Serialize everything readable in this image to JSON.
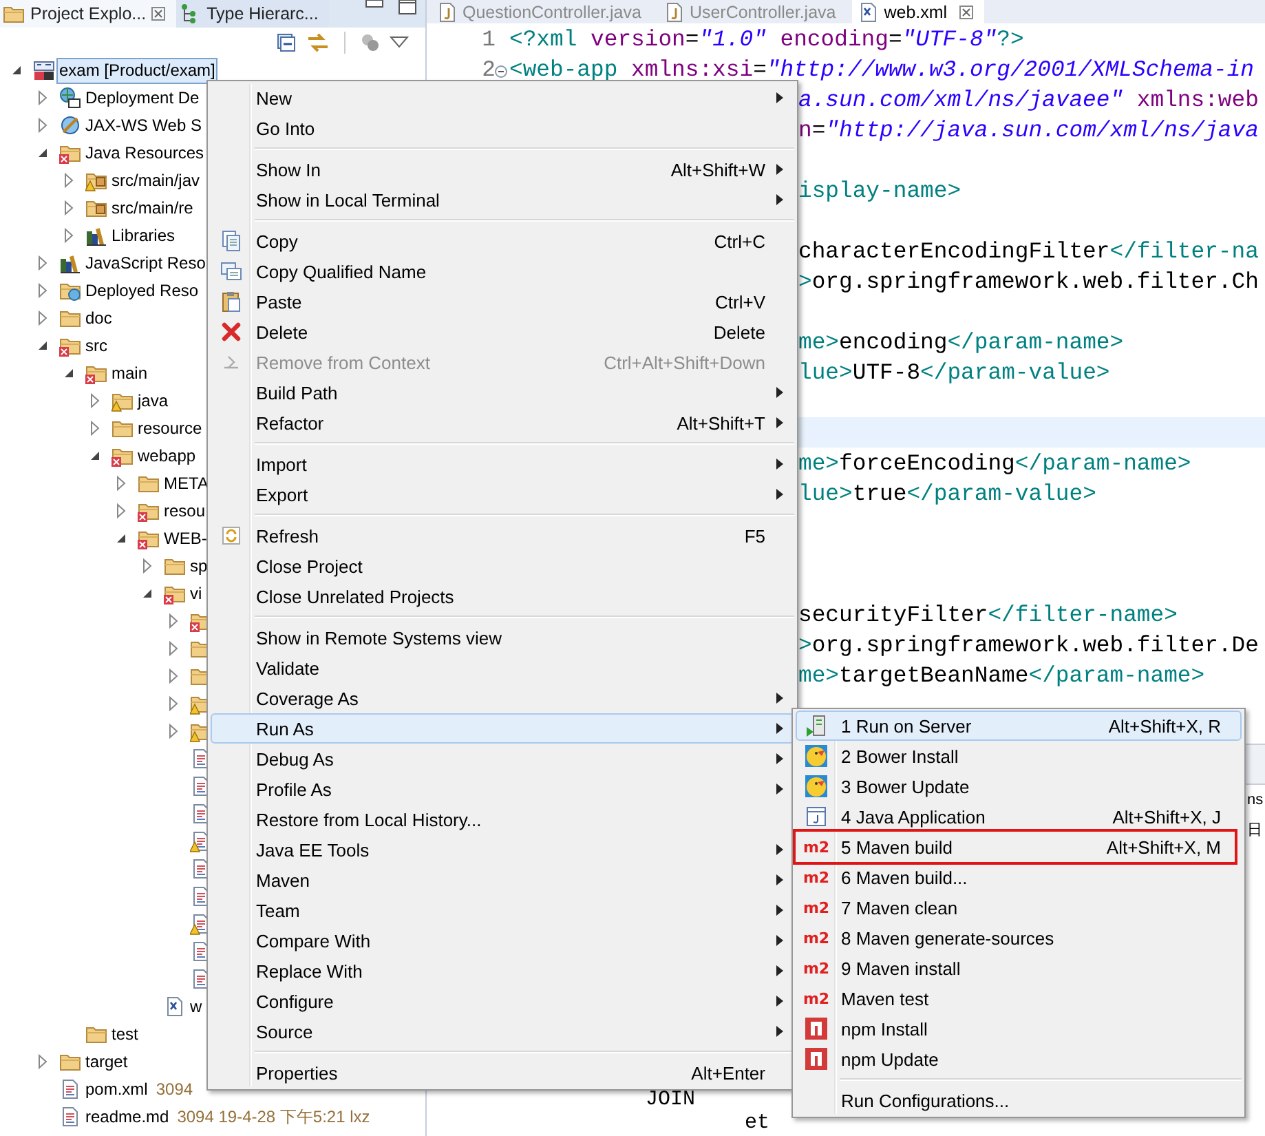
{
  "explorer": {
    "tabs": [
      {
        "label": "Project Explo...",
        "selected": true,
        "closable": true
      },
      {
        "label": "Type Hierarc...",
        "selected": false,
        "closable": false
      }
    ],
    "tree": [
      {
        "label": "exam [Product/exam]",
        "kind": "project",
        "expanded": true,
        "selected": true,
        "children": [
          {
            "label": "Deployment De",
            "kind": "deploy",
            "expanded": false,
            "selected": false
          },
          {
            "label": "JAX-WS Web S",
            "kind": "webservice",
            "expanded": false,
            "selected": false
          },
          {
            "label": "Java Resources",
            "kind": "javares",
            "expanded": true,
            "selected": false,
            "children": [
              {
                "label": "src/main/jav",
                "kind": "srcfolder-warning",
                "expanded": false,
                "selected": false
              },
              {
                "label": "src/main/re",
                "kind": "srcfolder",
                "expanded": false,
                "selected": false
              },
              {
                "label": "Libraries",
                "kind": "library",
                "expanded": false,
                "selected": false
              }
            ]
          },
          {
            "label": "JavaScript Reso",
            "kind": "library",
            "expanded": false,
            "selected": false
          },
          {
            "label": "Deployed Reso",
            "kind": "deployed",
            "expanded": false,
            "selected": false
          },
          {
            "label": "doc",
            "kind": "folder",
            "expanded": false,
            "selected": false
          },
          {
            "label": "src",
            "kind": "folder-error",
            "expanded": true,
            "selected": false,
            "children": [
              {
                "label": "main",
                "kind": "folder-error",
                "expanded": true,
                "selected": false,
                "children": [
                  {
                    "label": "java",
                    "kind": "folder-warning",
                    "expanded": false,
                    "selected": false
                  },
                  {
                    "label": "resource",
                    "kind": "folder",
                    "expanded": false,
                    "selected": false
                  },
                  {
                    "label": "webapp",
                    "kind": "folder-error",
                    "expanded": true,
                    "selected": false,
                    "children": [
                      {
                        "label": "META",
                        "kind": "folder",
                        "expanded": false,
                        "selected": false
                      },
                      {
                        "label": "resou",
                        "kind": "folder-error",
                        "expanded": false,
                        "selected": false
                      },
                      {
                        "label": "WEB-",
                        "kind": "folder-error",
                        "expanded": true,
                        "selected": false,
                        "children": [
                          {
                            "label": "sp",
                            "kind": "folder",
                            "expanded": false,
                            "selected": false
                          },
                          {
                            "label": "vi",
                            "kind": "folder-error",
                            "expanded": true,
                            "selected": false,
                            "children": [
                              {
                                "kind": "folder-error",
                                "expanded": false,
                                "selected": false
                              },
                              {
                                "kind": "folder",
                                "expanded": false,
                                "selected": false
                              },
                              {
                                "kind": "folder",
                                "expanded": false,
                                "selected": false
                              },
                              {
                                "kind": "folder-warning",
                                "expanded": false,
                                "selected": false
                              },
                              {
                                "kind": "folder-warning",
                                "expanded": false,
                                "selected": false
                              },
                              {
                                "kind": "file",
                                "selected": false
                              },
                              {
                                "kind": "file",
                                "selected": false
                              },
                              {
                                "kind": "file",
                                "selected": false
                              },
                              {
                                "kind": "file-warning",
                                "selected": false
                              },
                              {
                                "kind": "file",
                                "selected": false
                              },
                              {
                                "kind": "file",
                                "selected": false
                              },
                              {
                                "kind": "file-warning",
                                "selected": false
                              },
                              {
                                "kind": "file",
                                "selected": false
                              },
                              {
                                "kind": "file",
                                "selected": false
                              }
                            ]
                          },
                          {
                            "label": "w",
                            "kind": "xml",
                            "selected": false
                          }
                        ]
                      }
                    ]
                  }
                ]
              },
              {
                "label": "test",
                "kind": "folder",
                "selected": false
              }
            ]
          },
          {
            "label": "target",
            "kind": "folder",
            "expanded": false,
            "selected": false
          },
          {
            "label": "pom.xml",
            "kind": "file",
            "decoration": "3094",
            "selected": false
          },
          {
            "label": "readme.md",
            "kind": "file",
            "decoration": "3094  19-4-28 下午5:21  lxz",
            "selected": false
          }
        ]
      }
    ]
  },
  "editor": {
    "tabs": [
      {
        "label": "QuestionController.java",
        "kind": "java",
        "selected": false,
        "closable": false
      },
      {
        "label": "UserController.java",
        "kind": "java",
        "selected": false,
        "closable": false
      },
      {
        "label": "web.xml",
        "kind": "xml",
        "selected": true,
        "closable": true
      }
    ],
    "lines": [
      {
        "number": "1",
        "current": false,
        "clipped": false,
        "tokens": [
          {
            "kind": "tag",
            "text": "<?xml"
          },
          {
            "kind": "attr",
            "text": " version"
          },
          {
            "kind": "plain",
            "text": "="
          },
          {
            "kind": "string",
            "text": "\"1.0\""
          },
          {
            "kind": "attr",
            "text": " encoding"
          },
          {
            "kind": "plain",
            "text": "="
          },
          {
            "kind": "string",
            "text": "\"UTF-8\""
          },
          {
            "kind": "tag",
            "text": "?>"
          }
        ]
      },
      {
        "number": "2",
        "fold": true,
        "current": false,
        "clipped": false,
        "tokens": [
          {
            "kind": "tag",
            "text": "<web-app"
          },
          {
            "kind": "attr",
            "text": " xmlns:xsi"
          },
          {
            "kind": "plain",
            "text": "="
          },
          {
            "kind": "string",
            "text": "\"http://www.w3.org/2001/XMLSchema-in"
          }
        ]
      },
      {
        "current": false,
        "clipped": true,
        "tokens": [
          {
            "kind": "string",
            "text": "a.sun.com/xml/ns/javaee\""
          },
          {
            "kind": "attr",
            "text": " xmlns:web"
          }
        ]
      },
      {
        "current": false,
        "clipped": true,
        "tokens": [
          {
            "kind": "attr",
            "text": "n"
          },
          {
            "kind": "plain",
            "text": "="
          },
          {
            "kind": "string",
            "text": "\"http://java.sun.com/xml/ns/java"
          }
        ]
      },
      {
        "current": false
      },
      {
        "current": false,
        "clipped": true,
        "tokens": [
          {
            "kind": "tag",
            "text": "isplay-name>"
          }
        ]
      },
      {
        "current": false
      },
      {
        "current": false,
        "clipped": true,
        "tokens": [
          {
            "kind": "plain",
            "text": "characterEncodingFilter"
          },
          {
            "kind": "tag",
            "text": "</filter-na"
          }
        ]
      },
      {
        "current": false,
        "clipped": true,
        "tokens": [
          {
            "kind": "tag",
            "text": ">"
          },
          {
            "kind": "plain",
            "text": "org.springframework.web.filter.Ch"
          }
        ]
      },
      {
        "current": false
      },
      {
        "current": false,
        "clipped": true,
        "tokens": [
          {
            "kind": "tag",
            "text": "me>"
          },
          {
            "kind": "plain",
            "text": "encoding"
          },
          {
            "kind": "tag",
            "text": "</param-name>"
          }
        ]
      },
      {
        "current": false,
        "clipped": true,
        "tokens": [
          {
            "kind": "tag",
            "text": "lue>"
          },
          {
            "kind": "plain",
            "text": "UTF-8"
          },
          {
            "kind": "tag",
            "text": "</param-value>"
          }
        ]
      },
      {
        "current": false
      },
      {
        "current": true
      },
      {
        "current": false,
        "clipped": true,
        "tokens": [
          {
            "kind": "tag",
            "text": "me>"
          },
          {
            "kind": "plain",
            "text": "forceEncoding"
          },
          {
            "kind": "tag",
            "text": "</param-name>"
          }
        ]
      },
      {
        "current": false,
        "clipped": true,
        "tokens": [
          {
            "kind": "tag",
            "text": "lue>"
          },
          {
            "kind": "plain",
            "text": "true"
          },
          {
            "kind": "tag",
            "text": "</param-value>"
          }
        ]
      },
      {
        "current": false
      },
      {
        "current": false
      },
      {
        "current": false
      },
      {
        "current": false,
        "clipped": true,
        "tokens": [
          {
            "kind": "plain",
            "text": "securityFilter"
          },
          {
            "kind": "tag",
            "text": "</filter-name>"
          }
        ]
      },
      {
        "current": false,
        "clipped": true,
        "tokens": [
          {
            "kind": "tag",
            "text": ">"
          },
          {
            "kind": "plain",
            "text": "org.springframework.web.filter.De"
          }
        ]
      },
      {
        "current": false,
        "clipped": true,
        "tokens": [
          {
            "kind": "tag",
            "text": "me>"
          },
          {
            "kind": "plain",
            "text": "targetBeanName"
          },
          {
            "kind": "tag",
            "text": "</param-name>"
          }
        ]
      }
    ],
    "lower_lines": [
      {
        "current": false,
        "tokens": [
          {
            "kind": "plain",
            "text": "           JOIN"
          }
        ]
      },
      {
        "current": false,
        "tokens": [
          {
            "kind": "plain",
            "text": "                   et"
          }
        ]
      }
    ]
  },
  "context_menu": {
    "items": [
      {
        "kind": "plain",
        "label": "New",
        "submenu": true,
        "selected": false,
        "disabled": false
      },
      {
        "kind": "plain",
        "label": "Go Into",
        "submenu": false,
        "selected": false,
        "disabled": false
      },
      {
        "kind": "separator"
      },
      {
        "kind": "plain",
        "label": "Show In",
        "shortcut": "Alt+Shift+W",
        "submenu": true,
        "selected": false,
        "disabled": false
      },
      {
        "kind": "plain",
        "label": "Show in Local Terminal",
        "submenu": true,
        "selected": false,
        "disabled": false
      },
      {
        "kind": "separator"
      },
      {
        "kind": "copy",
        "label": "Copy",
        "shortcut": "Ctrl+C",
        "submenu": false,
        "selected": false,
        "disabled": false
      },
      {
        "kind": "copy-name",
        "label": "Copy Qualified Name",
        "submenu": false,
        "selected": false,
        "disabled": false
      },
      {
        "kind": "paste",
        "label": "Paste",
        "shortcut": "Ctrl+V",
        "submenu": false,
        "selected": false,
        "disabled": false
      },
      {
        "kind": "delete",
        "label": "Delete",
        "shortcut": "Delete",
        "submenu": false,
        "selected": false,
        "disabled": false
      },
      {
        "kind": "remove",
        "label": "Remove from Context",
        "shortcut": "Ctrl+Alt+Shift+Down",
        "submenu": false,
        "selected": false,
        "disabled": true
      },
      {
        "kind": "plain",
        "label": "Build Path",
        "submenu": true,
        "selected": false,
        "disabled": false
      },
      {
        "kind": "plain",
        "label": "Refactor",
        "shortcut": "Alt+Shift+T",
        "submenu": true,
        "selected": false,
        "disabled": false
      },
      {
        "kind": "separator"
      },
      {
        "kind": "plain",
        "label": "Import",
        "submenu": true,
        "selected": false,
        "disabled": false
      },
      {
        "kind": "plain",
        "label": "Export",
        "submenu": true,
        "selected": false,
        "disabled": false
      },
      {
        "kind": "separator"
      },
      {
        "kind": "refresh",
        "label": "Refresh",
        "shortcut": "F5",
        "submenu": false,
        "selected": false,
        "disabled": false
      },
      {
        "kind": "plain",
        "label": "Close Project",
        "submenu": false,
        "selected": false,
        "disabled": false
      },
      {
        "kind": "plain",
        "label": "Close Unrelated Projects",
        "submenu": false,
        "selected": false,
        "disabled": false
      },
      {
        "kind": "separator"
      },
      {
        "kind": "plain",
        "label": "Show in Remote Systems view",
        "submenu": false,
        "selected": false,
        "disabled": false
      },
      {
        "kind": "plain",
        "label": "Validate",
        "submenu": false,
        "selected": false,
        "disabled": false
      },
      {
        "kind": "plain",
        "label": "Coverage As",
        "submenu": true,
        "selected": false,
        "disabled": false
      },
      {
        "kind": "plain",
        "label": "Run As",
        "submenu": true,
        "selected": true,
        "disabled": false
      },
      {
        "kind": "plain",
        "label": "Debug As",
        "submenu": true,
        "selected": false,
        "disabled": false
      },
      {
        "kind": "plain",
        "label": "Profile As",
        "submenu": true,
        "selected": false,
        "disabled": false
      },
      {
        "kind": "plain",
        "label": "Restore from Local History...",
        "submenu": false,
        "selected": false,
        "disabled": false
      },
      {
        "kind": "plain",
        "label": "Java EE Tools",
        "submenu": true,
        "selected": false,
        "disabled": false
      },
      {
        "kind": "plain",
        "label": "Maven",
        "submenu": true,
        "selected": false,
        "disabled": false
      },
      {
        "kind": "plain",
        "label": "Team",
        "submenu": true,
        "selected": false,
        "disabled": false
      },
      {
        "kind": "plain",
        "label": "Compare With",
        "submenu": true,
        "selected": false,
        "disabled": false
      },
      {
        "kind": "plain",
        "label": "Replace With",
        "submenu": true,
        "selected": false,
        "disabled": false
      },
      {
        "kind": "plain",
        "label": "Configure",
        "submenu": true,
        "selected": false,
        "disabled": false
      },
      {
        "kind": "plain",
        "label": "Source",
        "submenu": true,
        "selected": false,
        "disabled": false
      },
      {
        "kind": "separator"
      },
      {
        "kind": "plain",
        "label": "Properties",
        "shortcut": "Alt+Enter",
        "submenu": false,
        "selected": false,
        "disabled": false
      }
    ]
  },
  "run_as_menu": {
    "items": [
      {
        "kind": "server",
        "label": "1 Run on Server",
        "shortcut": "Alt+Shift+X, R",
        "selected": true,
        "annotated": false
      },
      {
        "kind": "bower",
        "label": "2 Bower Install",
        "selected": false,
        "annotated": false
      },
      {
        "kind": "bower",
        "label": "3 Bower Update",
        "selected": false,
        "annotated": false
      },
      {
        "kind": "application",
        "label": "4 Java Application",
        "shortcut": "Alt+Shift+X, J",
        "selected": false,
        "annotated": false
      },
      {
        "kind": "maven",
        "badge": "m2",
        "label": "5 Maven build",
        "shortcut": "Alt+Shift+X, M",
        "selected": false,
        "annotated": true
      },
      {
        "kind": "maven",
        "badge": "m2",
        "label": "6 Maven build...",
        "selected": false,
        "annotated": false
      },
      {
        "kind": "maven",
        "badge": "m2",
        "label": "7 Maven clean",
        "selected": false,
        "annotated": false
      },
      {
        "kind": "maven",
        "badge": "m2",
        "label": "8 Maven generate-sources",
        "selected": false,
        "annotated": false
      },
      {
        "kind": "maven",
        "badge": "m2",
        "label": "9 Maven install",
        "selected": false,
        "annotated": false
      },
      {
        "kind": "maven",
        "badge": "m2",
        "label": "Maven test",
        "selected": false,
        "annotated": false
      },
      {
        "kind": "npm",
        "label": "npm Install",
        "selected": false,
        "annotated": false
      },
      {
        "kind": "npm",
        "label": "npm Update",
        "selected": false,
        "annotated": false
      },
      {
        "kind": "separator"
      },
      {
        "kind": "plain",
        "label": "Run Configurations...",
        "selected": false,
        "annotated": false
      }
    ]
  },
  "side_panel": {
    "texts": [
      "ns",
      "日"
    ]
  }
}
